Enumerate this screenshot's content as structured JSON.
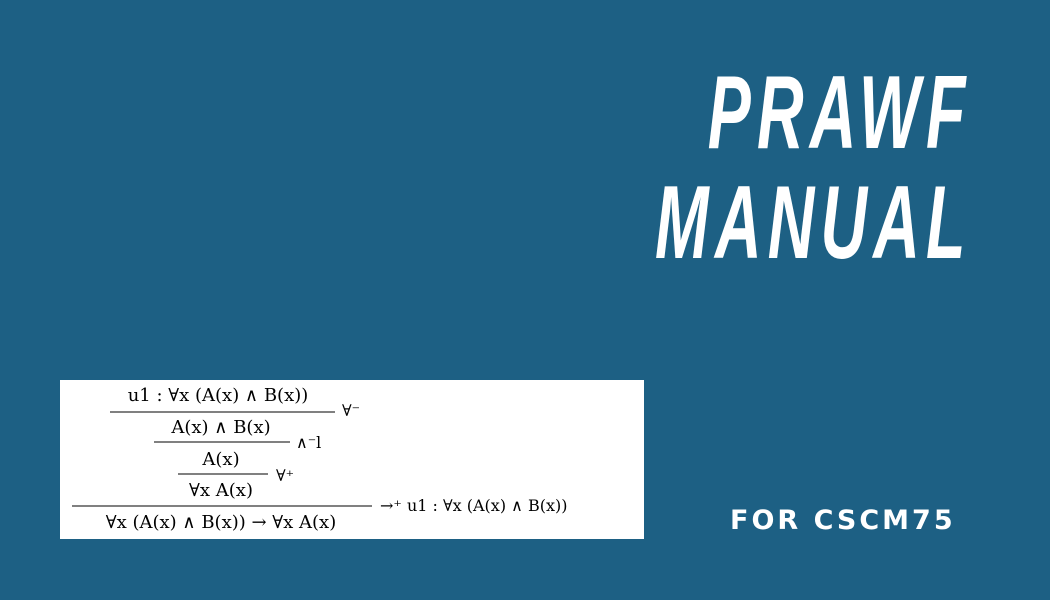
{
  "title": {
    "line1": "PRAWF",
    "line2": "MANUAL"
  },
  "subtitle": "FOR CSCM75",
  "proof": {
    "assumption": "u1 : ∀x (A(x) ∧ B(x))",
    "step1": "A(x) ∧ B(x)",
    "rule1": "∀⁻",
    "step2": "A(x)",
    "rule2": "∧⁻l",
    "step3": "∀x A(x)",
    "rule3": "∀⁺",
    "conclusion": "∀x (A(x) ∧ B(x)) → ∀x A(x)",
    "rule4": "→⁺  u1 : ∀x (A(x) ∧ B(x))"
  },
  "colors": {
    "background": "#1d6084",
    "text": "#ffffff",
    "box": "#ffffff"
  }
}
